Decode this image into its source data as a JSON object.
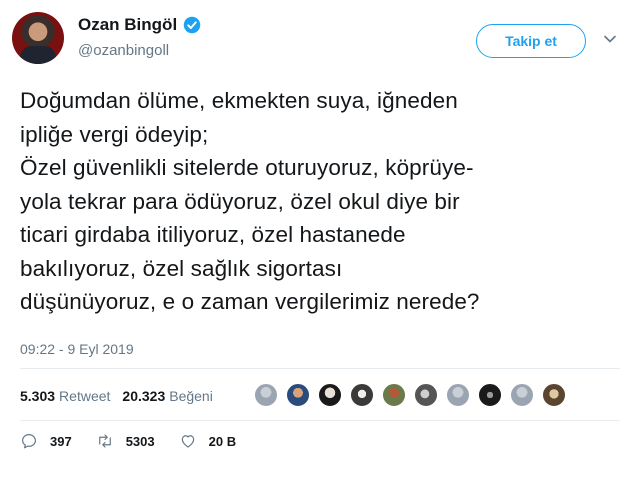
{
  "user": {
    "name": "Ozan Bingöl",
    "handle": "@ozanbingoll"
  },
  "follow_label": "Takip et",
  "tweet": {
    "lines": [
      "Doğumdan ölüme, ekmekten suya, iğneden",
      "ipliğe vergi ödeyip;",
      "Özel güvenlikli sitelerde oturuyoruz, köprüye-",
      "yola tekrar para ödüyoruz, özel okul diye bir",
      "ticari girdaba itiliyoruz, özel hastanede",
      "bakılıyoruz, özel sağlık sigortası",
      "düşünüyoruz, e o zaman vergilerimiz nerede?"
    ],
    "timestamp": "09:22 - 9 Eyl 2019"
  },
  "stats": {
    "retweets": "5.303",
    "retweets_label": "Retweet",
    "likes": "20.323",
    "likes_label": "Beğeni"
  },
  "actions": {
    "replies": "397",
    "retweets": "5303",
    "likes": "20 B"
  },
  "colors": {
    "accent": "#1da1f2",
    "secondary_text": "#657786",
    "divider": "#e6ecf0"
  },
  "icons": {
    "verified": "verified-badge-icon",
    "menu": "chevron-down-icon",
    "reply": "reply-icon",
    "retweet": "retweet-icon",
    "like": "heart-icon"
  }
}
